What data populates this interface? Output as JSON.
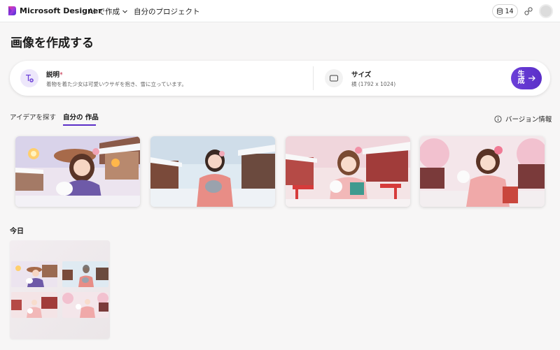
{
  "header": {
    "brand": "Microsoft Designer",
    "nav_ai": "AI で作成",
    "nav_projects": "自分のプロジェクト",
    "credits": "14"
  },
  "page": {
    "title": "画像を作成する"
  },
  "prompt": {
    "description_label": "説明",
    "required_mark": "*",
    "description_value": "着物を着た少女は可愛いウサギを抱き、雪に立っています。",
    "size_label": "サイズ",
    "size_value": "横 (1792 x 1024)",
    "generate_label": "生成"
  },
  "tabs": [
    {
      "label": "アイデアを探す",
      "active": false
    },
    {
      "label": "自分の 作品",
      "active": true
    }
  ],
  "version_info": "バージョン情報",
  "today": {
    "heading": "今日"
  },
  "colors": {
    "accent": "#5b2fc8",
    "page_bg": "#f7f6f6"
  },
  "icons": [
    "designer-logo-icon",
    "chevron-down-icon",
    "coin-icon",
    "link-icon",
    "text-plus-icon",
    "rectangle-icon",
    "arrow-right-icon",
    "info-icon"
  ]
}
